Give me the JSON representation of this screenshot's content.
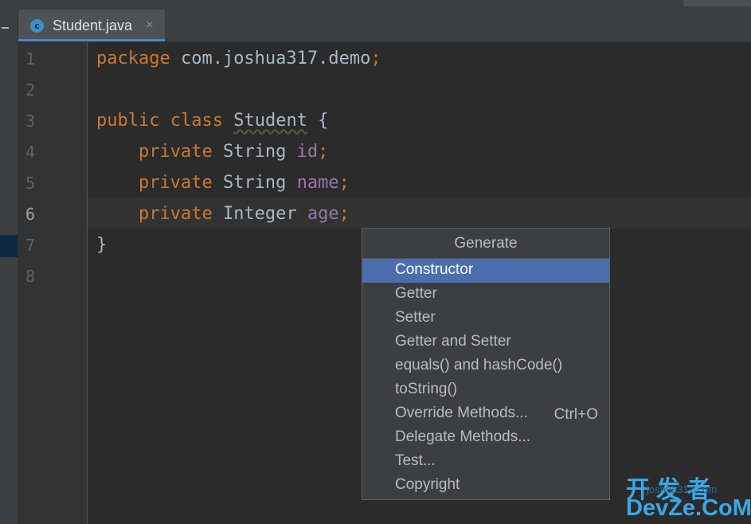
{
  "editor": {
    "tab": {
      "icon": "class-c-icon",
      "label": "Student.java",
      "close": "×"
    },
    "line_numbers": [
      "1",
      "2",
      "3",
      "4",
      "5",
      "6",
      "7",
      "8"
    ],
    "current_line": "6",
    "code": {
      "line1": {
        "kw": "package",
        "rest": " com.joshua317.demo",
        "semi": ";"
      },
      "line3": {
        "kw1": "public",
        "kw2": "class",
        "cls": "Student",
        "brace": " {"
      },
      "line4": {
        "kw": "private",
        "type": " String ",
        "field": "id",
        "semi": ";"
      },
      "line5": {
        "kw": "private",
        "type": " String ",
        "field": "name",
        "semi": ";"
      },
      "line6": {
        "kw": "private",
        "type": " Integer ",
        "field": "age",
        "semi": ";"
      },
      "line7": {
        "brace": "}"
      }
    }
  },
  "popup": {
    "title": "Generate",
    "items": [
      {
        "label": "Constructor",
        "selected": true
      },
      {
        "label": "Getter"
      },
      {
        "label": "Setter"
      },
      {
        "label": "Getter and Setter"
      },
      {
        "label": "equals() and hashCode()"
      },
      {
        "label": "toString()"
      },
      {
        "label": "Override Methods...",
        "shortcut": "Ctrl+O"
      },
      {
        "label": "Delegate Methods..."
      },
      {
        "label": "Test..."
      },
      {
        "label": "Copyright"
      }
    ]
  },
  "watermark": {
    "line1": "开发者",
    "line2": "DevZe.CoM",
    "overlay": "joshua317.com"
  },
  "colors": {
    "keyword": "#cc7832",
    "field": "#9876aa",
    "text": "#a9b7c6",
    "selection": "#4b6eaf",
    "tab_underline": "#4a88c7"
  }
}
